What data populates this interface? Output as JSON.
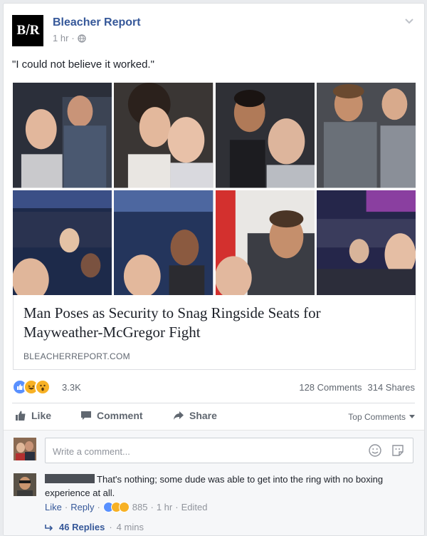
{
  "post": {
    "page_name": "Bleacher Report",
    "logo_text_left": "B",
    "logo_text_slash": "/",
    "logo_text_right": "R",
    "time": "1 hr",
    "separator": "·",
    "caption": "\"I could not believe it worked.\""
  },
  "link_preview": {
    "title": "Man Poses as Security to Snag Ringside Seats for Mayweather-McGregor Fight",
    "domain": "BLEACHERREPORT.COM"
  },
  "stats": {
    "reaction_count": "3.3K",
    "comments": "128 Comments",
    "shares": "314 Shares"
  },
  "actions": {
    "like": "Like",
    "comment": "Comment",
    "share": "Share",
    "top_comments": "Top Comments"
  },
  "comment_box": {
    "placeholder": "Write a comment..."
  },
  "comment": {
    "text": "That's nothing; some dude was able to get into the ring with no boxing experience at all.",
    "like": "Like",
    "reply": "Reply",
    "dot": "·",
    "reaction_count": "885",
    "time": "1 hr",
    "edited": "Edited",
    "replies": "46 Replies",
    "replies_time": "4 mins"
  },
  "colors": {
    "link_blue": "#365899",
    "like_blue": "#5890ff",
    "haha_yellow": "#f7b125"
  },
  "icons": [
    "globe-icon",
    "chevron-down-icon",
    "like-icon",
    "comment-icon",
    "share-icon",
    "emoji-icon",
    "sticker-icon",
    "reply-arrow-icon"
  ]
}
